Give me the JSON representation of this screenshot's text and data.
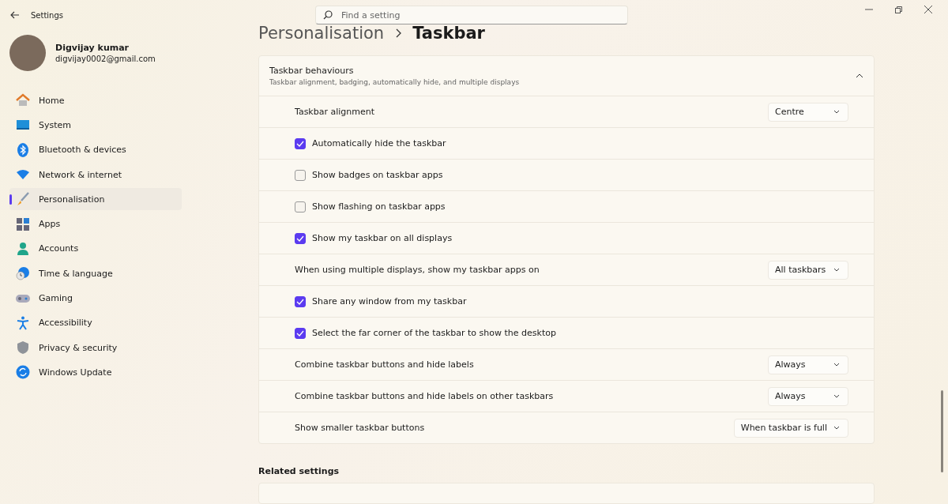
{
  "window": {
    "title": "Settings"
  },
  "search": {
    "placeholder": "Find a setting"
  },
  "user": {
    "name": "Digvijay kumar",
    "email": "digvijay0002@gmail.com"
  },
  "nav": [
    {
      "label": "Home",
      "selected": false
    },
    {
      "label": "System",
      "selected": false
    },
    {
      "label": "Bluetooth & devices",
      "selected": false
    },
    {
      "label": "Network & internet",
      "selected": false
    },
    {
      "label": "Personalisation",
      "selected": true
    },
    {
      "label": "Apps",
      "selected": false
    },
    {
      "label": "Accounts",
      "selected": false
    },
    {
      "label": "Time & language",
      "selected": false
    },
    {
      "label": "Gaming",
      "selected": false
    },
    {
      "label": "Accessibility",
      "selected": false
    },
    {
      "label": "Privacy & security",
      "selected": false
    },
    {
      "label": "Windows Update",
      "selected": false
    }
  ],
  "breadcrumb": [
    "Personalisation",
    "Taskbar"
  ],
  "section": {
    "title": "Taskbar behaviours",
    "subtitle": "Taskbar alignment, badging, automatically hide, and multiple displays",
    "expanded": true,
    "rows": [
      {
        "kind": "dropdown",
        "label": "Taskbar alignment",
        "value": "Centre"
      },
      {
        "kind": "checkbox",
        "label": "Automatically hide the taskbar",
        "checked": true
      },
      {
        "kind": "checkbox",
        "label": "Show badges on taskbar apps",
        "checked": false
      },
      {
        "kind": "checkbox",
        "label": "Show flashing on taskbar apps",
        "checked": false
      },
      {
        "kind": "checkbox",
        "label": "Show my taskbar on all displays",
        "checked": true
      },
      {
        "kind": "dropdown",
        "label": "When using multiple displays, show my taskbar apps on",
        "value": "All taskbars"
      },
      {
        "kind": "checkbox",
        "label": "Share any window from my taskbar",
        "checked": true
      },
      {
        "kind": "checkbox",
        "label": "Select the far corner of the taskbar to show the desktop",
        "checked": true
      },
      {
        "kind": "dropdown",
        "label": "Combine taskbar buttons and hide labels",
        "value": "Always"
      },
      {
        "kind": "dropdown",
        "label": "Combine taskbar buttons and hide labels on other taskbars",
        "value": "Always"
      },
      {
        "kind": "dropdown",
        "label": "Show smaller taskbar buttons",
        "value": "When taskbar is full"
      }
    ]
  },
  "related": {
    "title": "Related settings"
  }
}
